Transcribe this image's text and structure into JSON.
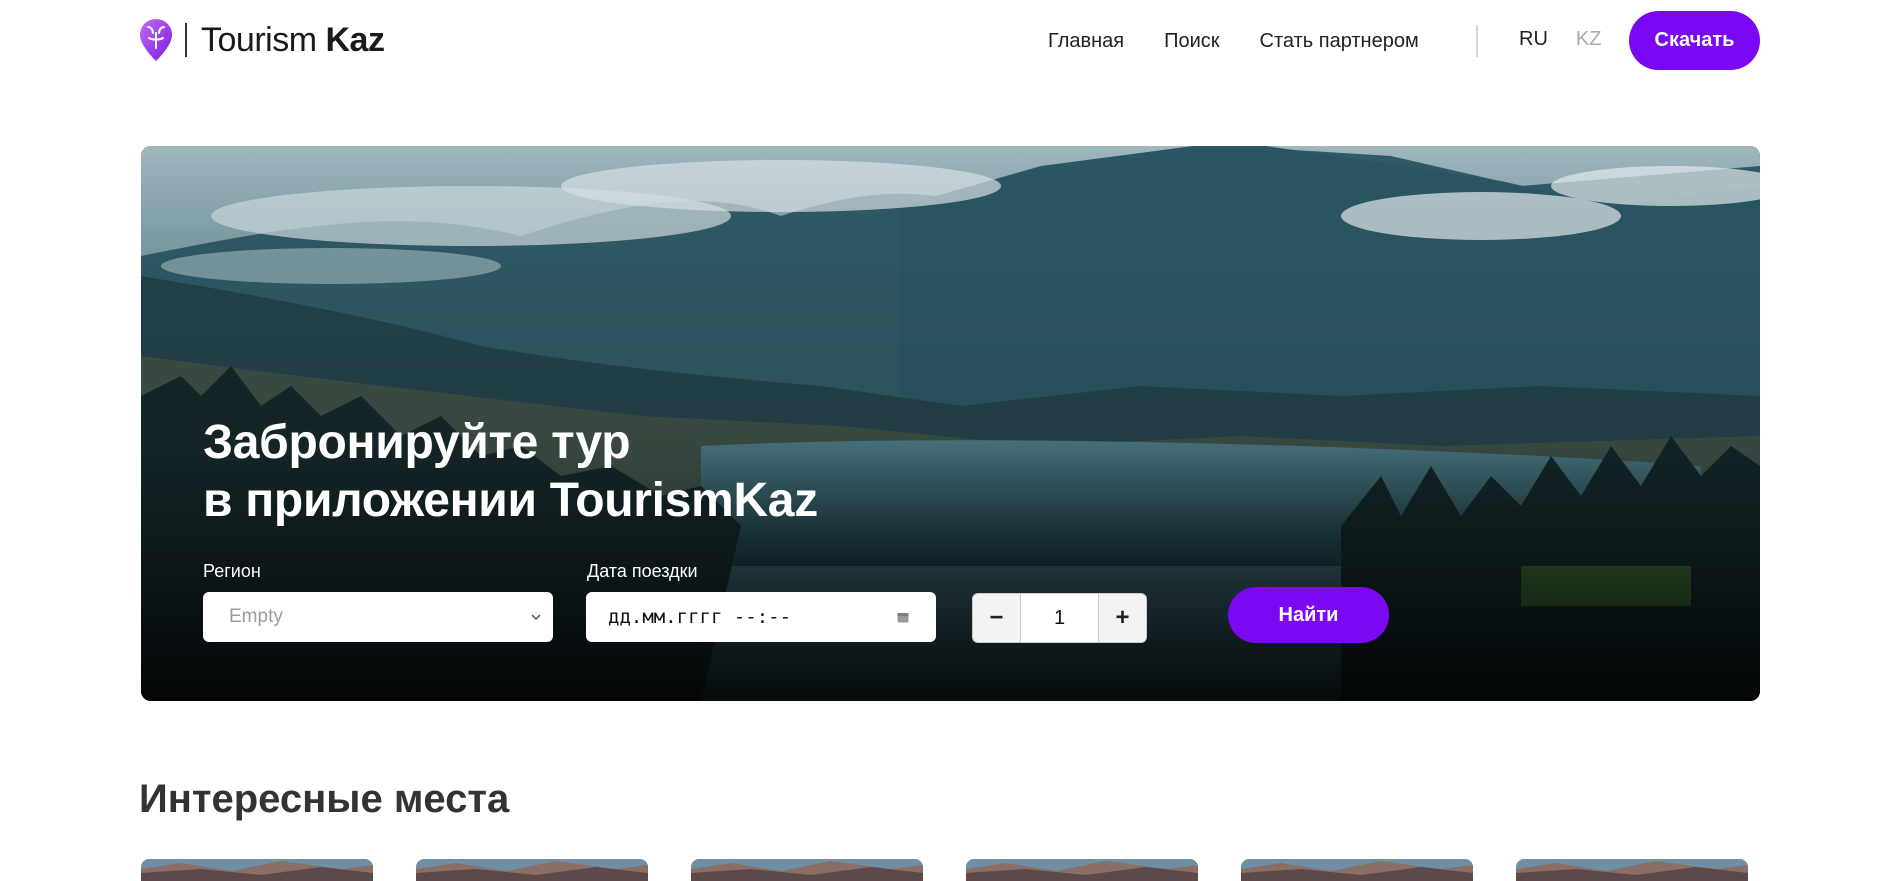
{
  "header": {
    "brand": {
      "name_light": "Tourism",
      "name_bold": "Kaz",
      "logo_icon": "pin-logo-icon"
    },
    "nav": [
      {
        "label": "Главная"
      },
      {
        "label": "Поиск"
      },
      {
        "label": "Стать партнером"
      }
    ],
    "languages": [
      {
        "label": "RU",
        "active": true
      },
      {
        "label": "KZ",
        "active": false
      }
    ],
    "download_label": "Скачать"
  },
  "hero": {
    "title_line1": "Забронируйте тур",
    "title_line2": "в приложении TourismKaz",
    "region": {
      "label": "Регион",
      "value": "Empty",
      "icon": "chevron-down-icon"
    },
    "date": {
      "label": "Дата поездки",
      "placeholder": "дд.мм.гггг --:--",
      "icon": "calendar-icon"
    },
    "travelers": {
      "minus": "−",
      "value": "1",
      "plus": "+"
    },
    "search_label": "Найти"
  },
  "places": {
    "title": "Интересные места",
    "cards": [
      {
        "image": "place-photo"
      },
      {
        "image": "place-photo"
      },
      {
        "image": "place-photo"
      },
      {
        "image": "place-photo"
      },
      {
        "image": "place-photo"
      },
      {
        "image": "place-photo"
      }
    ]
  },
  "colors": {
    "accent": "#7b08f3",
    "logo": "#a43df0",
    "text": "#222222",
    "muted": "#aaaaaa"
  }
}
